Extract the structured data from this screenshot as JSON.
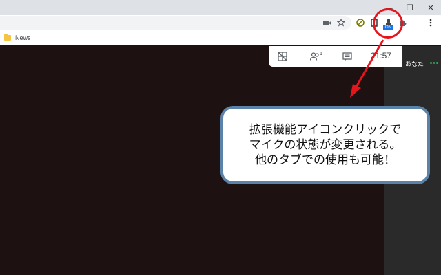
{
  "window": {
    "minimize_glyph": "—",
    "restore_glyph": "❐",
    "close_glyph": "✕"
  },
  "toolbar": {
    "icons": [
      "camera-icon",
      "star-icon",
      "extension-a-icon",
      "extension-b-icon",
      "mic-extension-icon",
      "puzzle-icon",
      "kebab-menu-icon"
    ],
    "mic_badge": "ON"
  },
  "bookmarks": {
    "items": [
      {
        "label": "News",
        "icon": "folder-icon"
      }
    ]
  },
  "meet": {
    "time": "21:57",
    "participants_count": "1",
    "you_label": "あなた"
  },
  "callout": {
    "lines": [
      "拡張機能アイコンクリックで",
      "マイクの状態が変更される。",
      "他のタブでの使用も可能！"
    ]
  },
  "colors": {
    "highlight": "#e8141c",
    "callout_border": "#5b82a8",
    "badge": "#1a73e8"
  }
}
